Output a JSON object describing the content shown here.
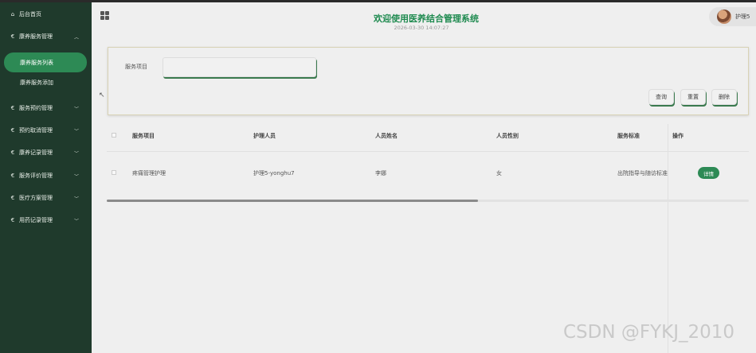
{
  "sidebar": {
    "home": "后台首页",
    "groups": [
      {
        "label": "康养服务管理",
        "expanded": true
      },
      {
        "label": "服务预约管理"
      },
      {
        "label": "预约取消管理"
      },
      {
        "label": "康养记录管理"
      },
      {
        "label": "服务评价管理"
      },
      {
        "label": "医疗方案管理"
      },
      {
        "label": "用药记录管理"
      }
    ],
    "sub_items": [
      "康养服务列表",
      "康养服务添加"
    ],
    "euro_glyph": "€",
    "home_glyph": "⌂",
    "chevron_up": "︿",
    "chevron_down": "﹀"
  },
  "header": {
    "title": "欢迎使用医养结合管理系统",
    "datetime": "2026-03-30 14:07:27",
    "username": "护理5"
  },
  "search": {
    "label": "服务项目",
    "value": "",
    "buttons": [
      "查询",
      "重置",
      "删除"
    ]
  },
  "table": {
    "headers": [
      "服务项目",
      "护理人员",
      "人员姓名",
      "人员性别",
      "服务标准",
      "操作"
    ],
    "rows": [
      {
        "service": "疼痛管理护理",
        "nurse": "护理5-yonghu7",
        "name": "李娜",
        "gender": "女",
        "standard": "出院指导与随访标准",
        "action": "详情"
      }
    ]
  },
  "watermark": "CSDN @FYKJ_2010",
  "colors": {
    "sidebar_bg": "#1f3a2c",
    "accent": "#2d8a55",
    "title": "#1e8a4f"
  }
}
